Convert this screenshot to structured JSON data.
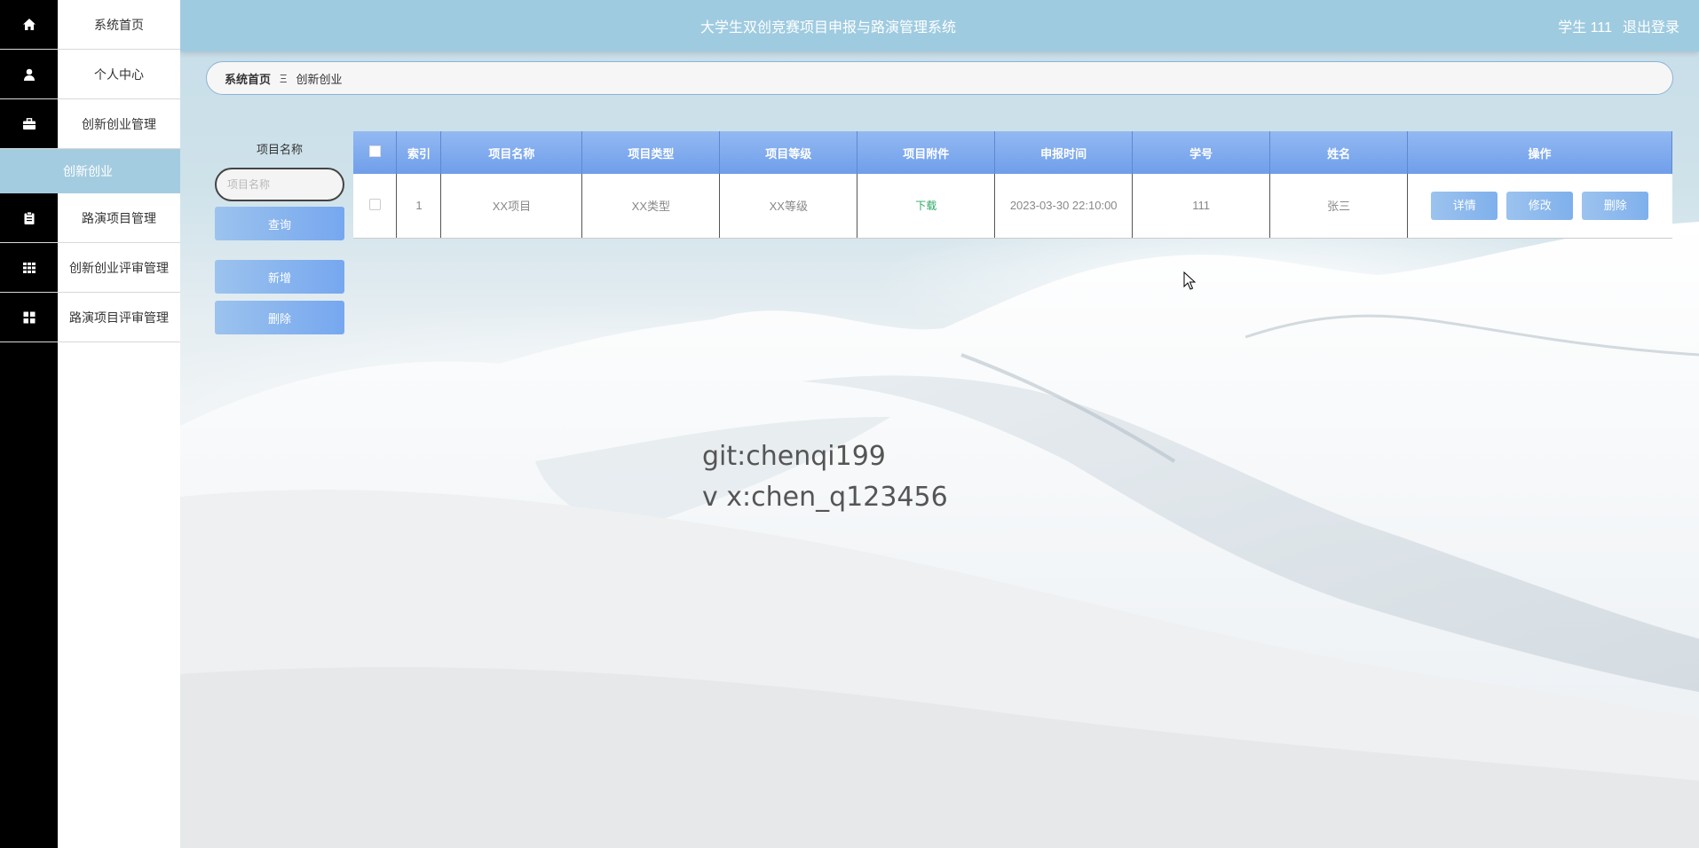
{
  "app": {
    "title": "大学生双创竞赛项目申报与路演管理系统",
    "user_label": "学生 111",
    "logout_label": "退出登录"
  },
  "sidebar": {
    "items": [
      {
        "label": "系统首页",
        "icon": "home-icon"
      },
      {
        "label": "个人中心",
        "icon": "user-icon"
      },
      {
        "label": "创新创业管理",
        "icon": "briefcase-icon"
      },
      {
        "label": "创新创业",
        "icon": "",
        "active": true
      },
      {
        "label": "路演项目管理",
        "icon": "clipboard-icon"
      },
      {
        "label": "创新创业评审管理",
        "icon": "grid-icon"
      },
      {
        "label": "路演项目评审管理",
        "icon": "apps-icon"
      }
    ]
  },
  "breadcrumb": {
    "home": "系统首页",
    "separator": "Ξ",
    "current": "创新创业"
  },
  "search": {
    "label": "项目名称",
    "placeholder": "项目名称",
    "value": "",
    "query_label": "查询",
    "add_label": "新增",
    "delete_label": "删除"
  },
  "table": {
    "headers": [
      "索引",
      "项目名称",
      "项目类型",
      "项目等级",
      "项目附件",
      "申报时间",
      "学号",
      "姓名",
      "操作"
    ],
    "rows": [
      {
        "index": "1",
        "name": "XX项目",
        "type": "XX类型",
        "level": "XX等级",
        "attachment": "下载",
        "time": "2023-03-30 22:10:00",
        "student_id": "111",
        "student_name": "张三"
      }
    ],
    "actions": {
      "detail": "详情",
      "edit": "修改",
      "delete": "删除"
    }
  },
  "watermark": {
    "line1": "git:chenqi199",
    "line2": "v x:chen_q123456"
  },
  "colors": {
    "topbar": "#9fcbe0",
    "active_nav": "#a4cce0",
    "table_header": "#7fa9ee",
    "button": "#8cb8ee",
    "download_link": "#2fa866"
  }
}
